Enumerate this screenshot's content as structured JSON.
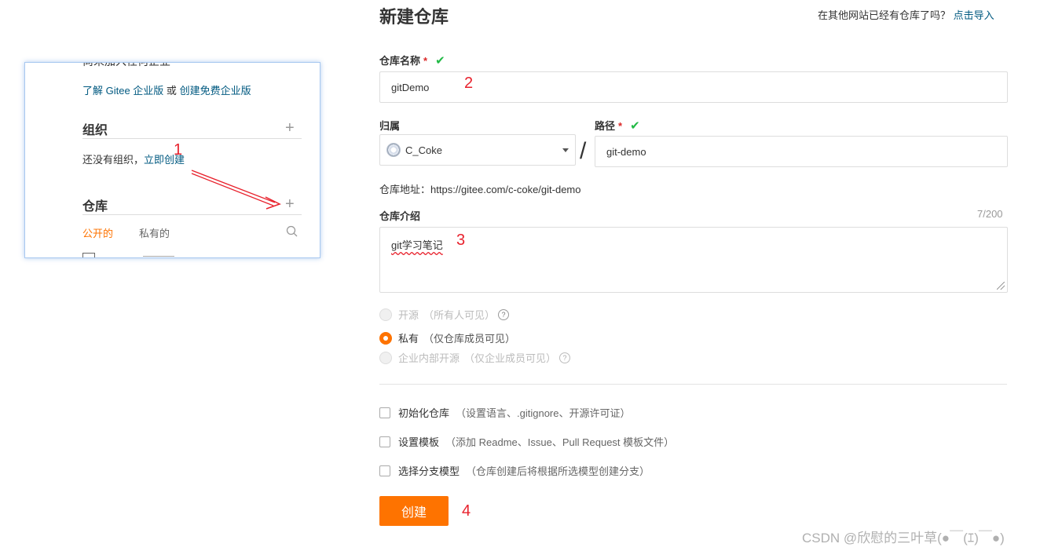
{
  "left_panel": {
    "cut_text": "尚未加入任何企业",
    "promo": {
      "link1": "了解 Gitee 企业版",
      "or": "或",
      "link2": "创建免费企业版"
    },
    "org_section": {
      "title": "组织",
      "empty_text": "还没有组织，",
      "create_link": "立即创建"
    },
    "repo_section": {
      "title": "仓库",
      "tab_public": "公开的",
      "tab_private": "私有的"
    },
    "plus_symbol": "+"
  },
  "annotations": {
    "a1": "1",
    "a2": "2",
    "a3": "3",
    "a4": "4"
  },
  "form": {
    "title": "新建仓库",
    "import_question": "在其他网站已经有仓库了吗？",
    "import_link": "点击导入",
    "repo_name": {
      "label": "仓库名称",
      "required_mark": "*",
      "value": "gitDemo"
    },
    "owner": {
      "label": "归属",
      "value": "C_Coke"
    },
    "separator": "/",
    "path": {
      "label": "路径",
      "required_mark": "*",
      "value": "git-demo"
    },
    "repo_url": {
      "label": "仓库地址：",
      "value": "https://gitee.com/c-coke/git-demo"
    },
    "description": {
      "label": "仓库介绍",
      "counter": "7/200",
      "value": "git学习笔记"
    },
    "visibility": [
      {
        "label": "开源",
        "note": "（所有人可见）",
        "selected": false,
        "disabled": true
      },
      {
        "label": "私有",
        "note": "（仅仓库成员可见）",
        "selected": true,
        "disabled": false
      },
      {
        "label": "企业内部开源",
        "note": "（仅企业成员可见）",
        "selected": false,
        "disabled": true
      }
    ],
    "options": [
      {
        "label": "初始化仓库",
        "note": "（设置语言、.gitignore、开源许可证）"
      },
      {
        "label": "设置模板",
        "note": "（添加 Readme、Issue、Pull Request 模板文件）"
      },
      {
        "label": "选择分支模型",
        "note": "（仓库创建后将根据所选模型创建分支）"
      }
    ],
    "create_button": "创建"
  },
  "watermark": "CSDN @欣慰的三叶草(●￣(ｴ)￣●)",
  "colors": {
    "accent": "#fe7300",
    "link": "#005980",
    "annotation": "#e8222d",
    "success": "#21ba45"
  }
}
